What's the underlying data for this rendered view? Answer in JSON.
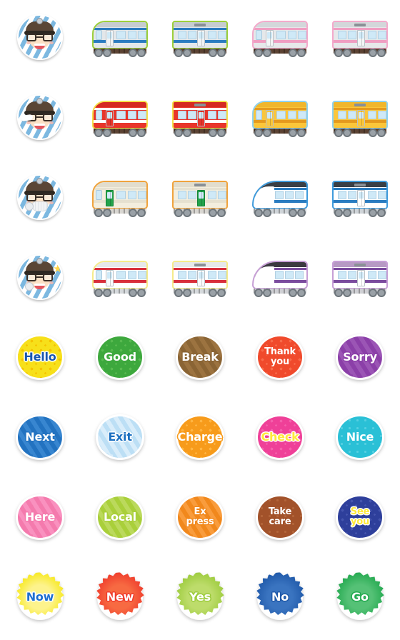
{
  "sheet": {
    "title": "Train Emoji Sticker Sheet",
    "columns": 5,
    "rows": 8,
    "background": "#ffffff"
  },
  "cells": [
    {
      "id": "r1c1",
      "kind": "conductor-face",
      "variant": "plain",
      "label": "Conductor face with cap and glasses",
      "colors": {
        "stripe": "#7cb8e0",
        "skin": "#fbe0c4",
        "cap": "#5a4636",
        "brim": "#2e2821"
      }
    },
    {
      "id": "r1c2",
      "kind": "train-front",
      "label": "Silver commuter train front car",
      "colors": {
        "body": "#e3e7ea",
        "roof": "#c6ccd0",
        "stripe": "#2b7cc0",
        "outline": "#9ccf3a",
        "under": "#5b4232",
        "door": "#f0f3f5"
      }
    },
    {
      "id": "r1c3",
      "kind": "train-middle",
      "label": "Silver commuter train middle car",
      "colors": {
        "body": "#e3e7ea",
        "roof": "#c6ccd0",
        "stripe": "#2b7cc0",
        "outline": "#9ccf3a",
        "under": "#5b4232",
        "door": "#f0f3f5"
      }
    },
    {
      "id": "r1c4",
      "kind": "train-front",
      "label": "Pink and white commuter train front car",
      "colors": {
        "body": "#e6e8ea",
        "roof": "#d3d7da",
        "stripe": "#ef9ec2",
        "outline": "#f3aacb",
        "under": "#5b4232",
        "door": "#f3f5f6"
      }
    },
    {
      "id": "r1c5",
      "kind": "train-middle",
      "label": "Pink and white commuter train middle car",
      "colors": {
        "body": "#e6e8ea",
        "roof": "#d3d7da",
        "stripe": "#ef9ec2",
        "outline": "#f3aacb",
        "under": "#5b4232",
        "door": "#f3f5f6"
      }
    },
    {
      "id": "r2c1",
      "kind": "conductor-face",
      "variant": "swoosh",
      "label": "Conductor face with white swoosh",
      "colors": {
        "stripe": "#7cb8e0",
        "skin": "#fbe0c4",
        "cap": "#5a4636",
        "brim": "#2e2821"
      }
    },
    {
      "id": "r2c2",
      "kind": "train-front",
      "label": "Red express train front car",
      "colors": {
        "body": "#e8352b",
        "roof": "#d52a22",
        "stripe": "#ffffff",
        "outline": "#f5e04a",
        "under": "#5b4232",
        "door": "#e8352b"
      }
    },
    {
      "id": "r2c3",
      "kind": "train-middle",
      "label": "Red express train middle car",
      "colors": {
        "body": "#e8352b",
        "roof": "#d52a22",
        "stripe": "#ffffff",
        "outline": "#f5e04a",
        "under": "#5b4232",
        "door": "#e8352b"
      }
    },
    {
      "id": "r2c4",
      "kind": "train-front",
      "label": "Yellow commuter train front car",
      "colors": {
        "body": "#fbc63a",
        "roof": "#f0b62c",
        "stripe": "#e59a1e",
        "outline": "#8fd2ef",
        "under": "#5b4232",
        "door": "#fbc63a"
      }
    },
    {
      "id": "r2c5",
      "kind": "train-middle",
      "label": "Yellow commuter train middle car",
      "colors": {
        "body": "#fbc63a",
        "roof": "#f0b62c",
        "stripe": "#e59a1e",
        "outline": "#8fd2ef",
        "under": "#5b4232",
        "door": "#fbc63a"
      }
    },
    {
      "id": "r3c1",
      "kind": "conductor-face",
      "variant": "mask",
      "label": "Conductor face with mask and whistle",
      "colors": {
        "stripe": "#7cb8e0",
        "skin": "#fbe0c4",
        "cap": "#5a4636",
        "brim": "#2e2821"
      }
    },
    {
      "id": "r3c2",
      "kind": "train-front",
      "label": "Cream train with green doors front car",
      "colors": {
        "body": "#f3eede",
        "roof": "#e2ddcd",
        "stripe": "#e6e1d0",
        "outline": "#f0a33c",
        "under": "#d8d6d1",
        "door": "#22a24a"
      }
    },
    {
      "id": "r3c3",
      "kind": "train-middle",
      "label": "Cream train with green doors middle car",
      "colors": {
        "body": "#f3eede",
        "roof": "#e2ddcd",
        "stripe": "#e6e1d0",
        "outline": "#f0a33c",
        "under": "#d8d6d1",
        "door": "#22a24a"
      }
    },
    {
      "id": "r3c4",
      "kind": "train-nose",
      "label": "Blue and white limited express nose car",
      "colors": {
        "body": "#ffffff",
        "roof": "#3a3f45",
        "stripe": "#2b7cc0",
        "outline": "#3f9bdc",
        "under": "#cfd4d8",
        "door": "#ffffff"
      }
    },
    {
      "id": "r3c5",
      "kind": "train-middle",
      "label": "Blue and white limited express middle car",
      "colors": {
        "body": "#ffffff",
        "roof": "#3a3f45",
        "stripe": "#2b7cc0",
        "outline": "#3f9bdc",
        "under": "#cfd4d8",
        "door": "#ffffff"
      }
    },
    {
      "id": "r4c1",
      "kind": "conductor-face",
      "variant": "star",
      "label": "Conductor face with gold star",
      "colors": {
        "stripe": "#7cb8e0",
        "skin": "#fbe0c4",
        "cap": "#5a4636",
        "brim": "#2e2821"
      }
    },
    {
      "id": "r4c2",
      "kind": "train-front",
      "label": "White train with red stripe front car",
      "colors": {
        "body": "#ffffff",
        "roof": "#e6e8ea",
        "stripe": "#d8303c",
        "outline": "#f5eb8a",
        "under": "#d5d9dc",
        "door": "#fafbfc"
      }
    },
    {
      "id": "r4c3",
      "kind": "train-middle",
      "label": "White train with red stripe middle car",
      "colors": {
        "body": "#ffffff",
        "roof": "#e6e8ea",
        "stripe": "#d8303c",
        "outline": "#f5eb8a",
        "under": "#d5d9dc",
        "door": "#fafbfc"
      }
    },
    {
      "id": "r4c4",
      "kind": "train-nose",
      "label": "Purple shinkansen nose car",
      "colors": {
        "body": "#ffffff",
        "roof": "#3b3a40",
        "stripe": "#7b4c9e",
        "outline": "#c79fd6",
        "under": "#cfd0d4",
        "door": "#ffffff"
      }
    },
    {
      "id": "r4c5",
      "kind": "train-middle",
      "label": "Purple shinkansen middle car",
      "colors": {
        "body": "#ffffff",
        "roof": "#b79ac4",
        "stripe": "#7b4c9e",
        "outline": "#c79fd6",
        "under": "#cfd0d4",
        "door": "#ffffff"
      }
    },
    {
      "id": "r5c1",
      "kind": "badge",
      "shape": "speech-circle",
      "text": "Hello",
      "lines": 1,
      "colors": {
        "fill": "#f7e01a",
        "text": "#1856b0",
        "stroke": "#ffffff",
        "pattern": "stars",
        "patternColor": "#f5c400"
      }
    },
    {
      "id": "r5c2",
      "kind": "badge",
      "shape": "speech-circle",
      "text": "Good",
      "lines": 1,
      "colors": {
        "fill": "#3da83d",
        "text": "#ffffff",
        "stroke": "#ffffff",
        "pattern": "stars",
        "patternColor": "#57b94f"
      }
    },
    {
      "id": "r5c3",
      "kind": "badge",
      "shape": "speech-circle",
      "text": "Break",
      "lines": 1,
      "colors": {
        "fill": "#8a6434",
        "text": "#ffffff",
        "stroke": "#ffffff",
        "pattern": "stripes",
        "patternColor": "#9c7340"
      }
    },
    {
      "id": "r5c4",
      "kind": "badge",
      "shape": "speech-circle",
      "text": "Thank\nyou",
      "lines": 2,
      "colors": {
        "fill": "#f04a2c",
        "text": "#ffffff",
        "stroke": "#ffffff",
        "pattern": "stars",
        "patternColor": "#f76a4a"
      }
    },
    {
      "id": "r5c5",
      "kind": "badge",
      "shape": "speech-circle",
      "text": "Sorry",
      "lines": 1,
      "colors": {
        "fill": "#8b3fa8",
        "text": "#ffffff",
        "stroke": "#ffffff",
        "pattern": "stripes",
        "patternColor": "#9b55b5"
      }
    },
    {
      "id": "r6c1",
      "kind": "badge",
      "shape": "speech-circle",
      "text": "Next",
      "lines": 1,
      "colors": {
        "fill": "#2272c0",
        "text": "#ffffff",
        "stroke": "#ffffff",
        "pattern": "stripes",
        "patternColor": "#3886d0"
      }
    },
    {
      "id": "r6c2",
      "kind": "badge",
      "shape": "speech-circle",
      "text": "Exit",
      "lines": 1,
      "colors": {
        "fill": "#d9edfa",
        "text": "#1a6fc0",
        "stroke": "#ffffff",
        "pattern": "stripes",
        "patternColor": "#bcdff5"
      }
    },
    {
      "id": "r6c3",
      "kind": "badge",
      "shape": "speech-circle",
      "text": "Charge",
      "lines": 1,
      "colors": {
        "fill": "#f79b1b",
        "text": "#ffffff",
        "stroke": "#ffffff",
        "pattern": "stars",
        "patternColor": "#ffb441"
      }
    },
    {
      "id": "r6c4",
      "kind": "badge",
      "shape": "speech-circle",
      "text": "Check",
      "lines": 1,
      "colors": {
        "fill": "#ef4098",
        "text": "#ffe93a",
        "stroke": "#ffffff",
        "pattern": "stars",
        "patternColor": "#f45fab"
      }
    },
    {
      "id": "r6c5",
      "kind": "badge",
      "shape": "speech-circle",
      "text": "Nice",
      "lines": 1,
      "colors": {
        "fill": "#2ac0d6",
        "text": "#ffffff",
        "stroke": "#ffffff",
        "pattern": "dots",
        "patternColor": "#55cfe1"
      }
    },
    {
      "id": "r7c1",
      "kind": "badge",
      "shape": "speech-circle",
      "text": "Here",
      "lines": 1,
      "colors": {
        "fill": "#f47aad",
        "text": "#ffffff",
        "stroke": "#ffffff",
        "pattern": "stripes",
        "patternColor": "#f991bf"
      }
    },
    {
      "id": "r7c2",
      "kind": "badge",
      "shape": "speech-circle",
      "text": "Local",
      "lines": 1,
      "colors": {
        "fill": "#a9cf3a",
        "text": "#ffffff",
        "stroke": "#ffffff",
        "pattern": "stripes",
        "patternColor": "#bbd95c"
      }
    },
    {
      "id": "r7c3",
      "kind": "badge",
      "shape": "speech-circle",
      "text": "Ex\npress",
      "lines": 2,
      "colors": {
        "fill": "#f1881c",
        "text": "#ffffff",
        "stroke": "#ffffff",
        "pattern": "stripes",
        "patternColor": "#f99c3c"
      }
    },
    {
      "id": "r7c4",
      "kind": "badge",
      "shape": "speech-circle",
      "text": "Take\ncare",
      "lines": 2,
      "colors": {
        "fill": "#a2522a",
        "text": "#ffffff",
        "stroke": "#ffffff",
        "pattern": "dots",
        "patternColor": "#b3653a"
      }
    },
    {
      "id": "r7c5",
      "kind": "badge",
      "shape": "speech-circle",
      "text": "See\nyou",
      "lines": 2,
      "colors": {
        "fill": "#2e3f9b",
        "text": "#ffe93a",
        "stroke": "#ffffff",
        "pattern": "stars",
        "patternColor": "#4454ad"
      }
    },
    {
      "id": "r8c1",
      "kind": "badge",
      "shape": "burst",
      "text": "Now",
      "lines": 1,
      "colors": {
        "fill": "#f7e81a",
        "text": "#1f6fd0",
        "stroke": "#ffffff",
        "pattern": "radial",
        "patternColor": "#fdf38c"
      }
    },
    {
      "id": "r8c2",
      "kind": "badge",
      "shape": "burst",
      "text": "New",
      "lines": 1,
      "colors": {
        "fill": "#ef3b2c",
        "text": "#ffffff",
        "stroke": "#ffffff",
        "pattern": "radial",
        "patternColor": "#f76a42"
      }
    },
    {
      "id": "r8c3",
      "kind": "badge",
      "shape": "burst",
      "text": "Yes",
      "lines": 1,
      "colors": {
        "fill": "#9ccb3c",
        "text": "#ffffff",
        "stroke": "#ffffff",
        "pattern": "radial",
        "patternColor": "#bddc6b"
      }
    },
    {
      "id": "r8c4",
      "kind": "badge",
      "shape": "burst",
      "text": "No",
      "lines": 1,
      "colors": {
        "fill": "#1f58a8",
        "text": "#ffffff",
        "stroke": "#ffffff",
        "pattern": "radial",
        "patternColor": "#3a74c0"
      }
    },
    {
      "id": "r8c5",
      "kind": "badge",
      "shape": "burst",
      "text": "Go",
      "lines": 1,
      "colors": {
        "fill": "#22a84e",
        "text": "#ffffff",
        "stroke": "#ffffff",
        "pattern": "radial",
        "patternColor": "#55c176"
      }
    }
  ]
}
